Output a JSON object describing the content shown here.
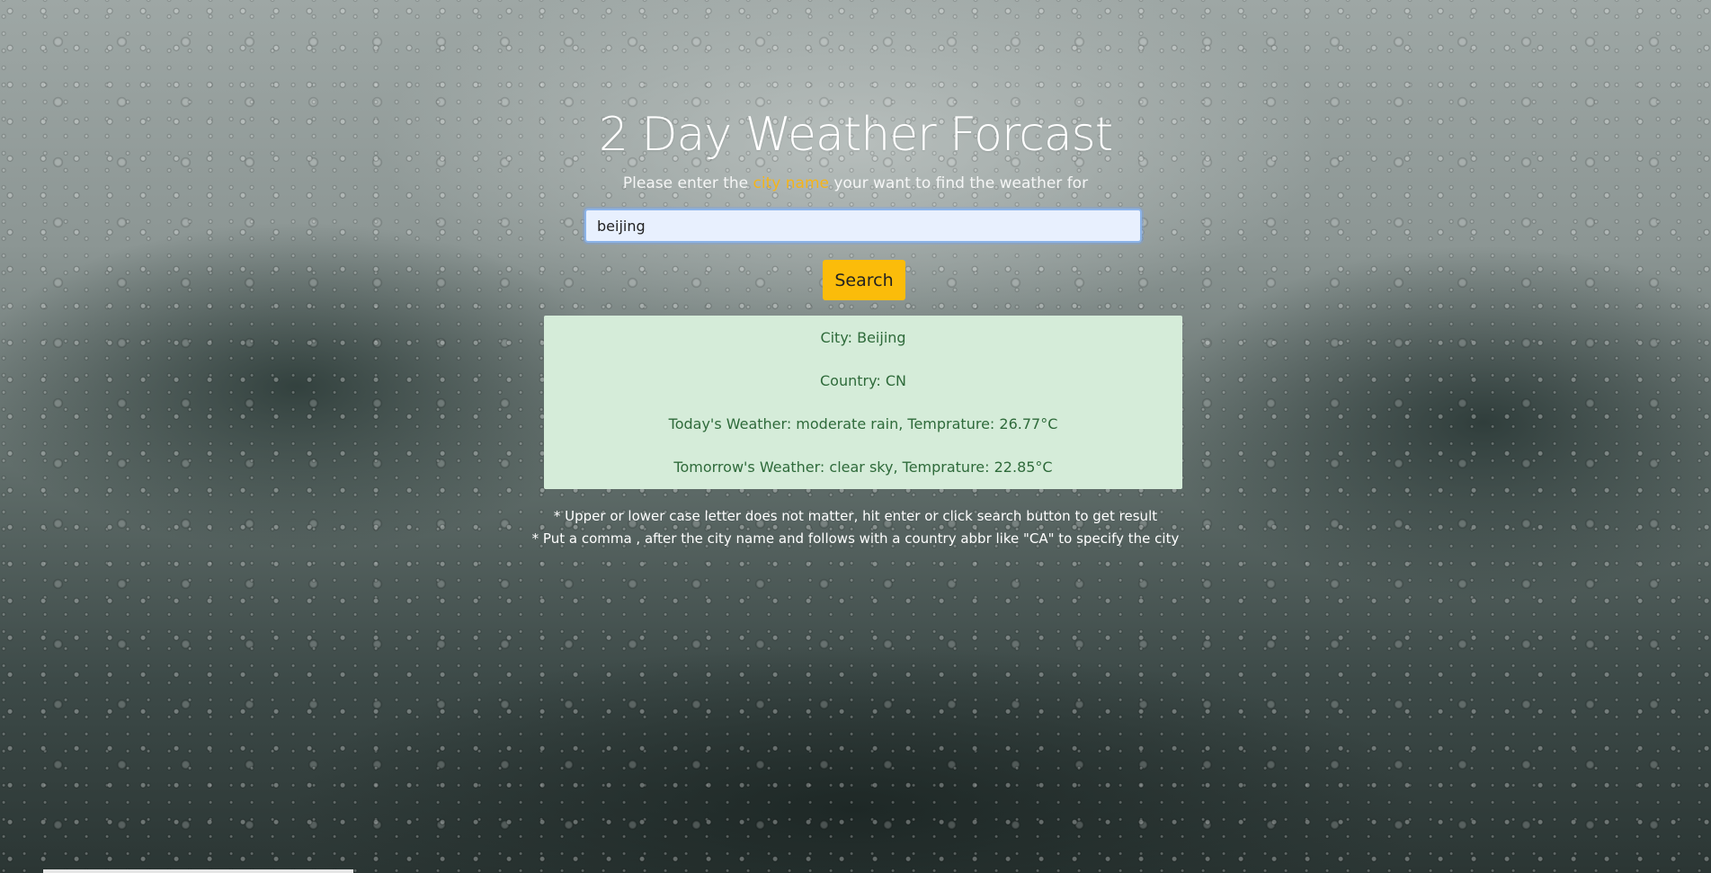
{
  "page": {
    "title": "2 Day Weather Forcast",
    "subtitle": {
      "before": "Please enter the ",
      "highlight": "city name",
      "after": " your want to find the weather for"
    }
  },
  "search": {
    "value": "beijing",
    "placeholder": "",
    "button_label": "Search"
  },
  "result": {
    "city": "City: Beijing",
    "country": "Country: CN",
    "today": "Today's Weather: moderate rain, Temprature: 26.77°C",
    "tomorrow": "Tomorrow's Weather: clear sky, Temprature: 22.85°C"
  },
  "notes": [
    "* Upper or lower case letter does not matter, hit enter or click search button to get result",
    "* Put a comma , after the city name and follows with a country abbr like \"CA\" to specify the city"
  ],
  "colors": {
    "accent": "#fbbc0a",
    "result_bg": "#d5ecd9",
    "result_text": "#2e6a3a"
  }
}
